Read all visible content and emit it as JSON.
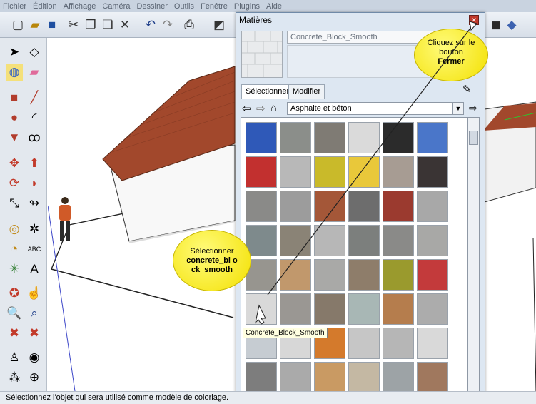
{
  "menubar": {
    "items": [
      "Fichier",
      "Édition",
      "Affichage",
      "Caméra",
      "Dessiner",
      "Outils",
      "Fenêtre",
      "Plugins",
      "Aide"
    ]
  },
  "panel": {
    "title": "Matières",
    "material_name": "Concrete_Block_Smooth",
    "tabs": [
      "Sélectionner",
      "Modifier"
    ],
    "collection": "Asphalte et béton"
  },
  "callouts": {
    "close_line1": "Cliquez sur le",
    "close_line2": "bouton",
    "close_bold": "Fermer",
    "select_line1": "Sélectionner",
    "select_bold": "concrete_bl ock_smooth"
  },
  "tooltip": "Concrete_Block_Smooth",
  "status": "Sélectionnez l'objet qui sera utilisé comme modèle de coloriage.",
  "swatches": [
    "#2f59b8",
    "#8b8e8a",
    "#7f7b74",
    "#dadada",
    "#2b2b2b",
    "#4a76c9",
    "#c2302f",
    "#b8b8b8",
    "#c9ba2a",
    "#e9c83a",
    "#a79c93",
    "#3a3434",
    "#8a8a88",
    "#9c9c9c",
    "#a45738",
    "#6d6d6d",
    "#9b3a2f",
    "#a8a8a8",
    "#7e8a8c",
    "#8a8376",
    "#b7b7b7",
    "#7c7f7d",
    "#8a8a88",
    "#a8a8a6",
    "#97958f",
    "#c1986c",
    "#a9a9a7",
    "#8e7d6a",
    "#9a9a2d",
    "#c33a3b",
    "#d9d9d9",
    "#9a9793",
    "#86796a",
    "#a8b7b5",
    "#b57d4d",
    "#acacac",
    "#c6ccd2",
    "#d7d7d7",
    "#d47a2c",
    "#c6c6c6",
    "#b6b6b6",
    "#d9d9d9",
    "#7d7d7d",
    "#aaaaaa",
    "#c99a63",
    "#c4b8a3",
    "#9da3a6",
    "#a0785e"
  ]
}
